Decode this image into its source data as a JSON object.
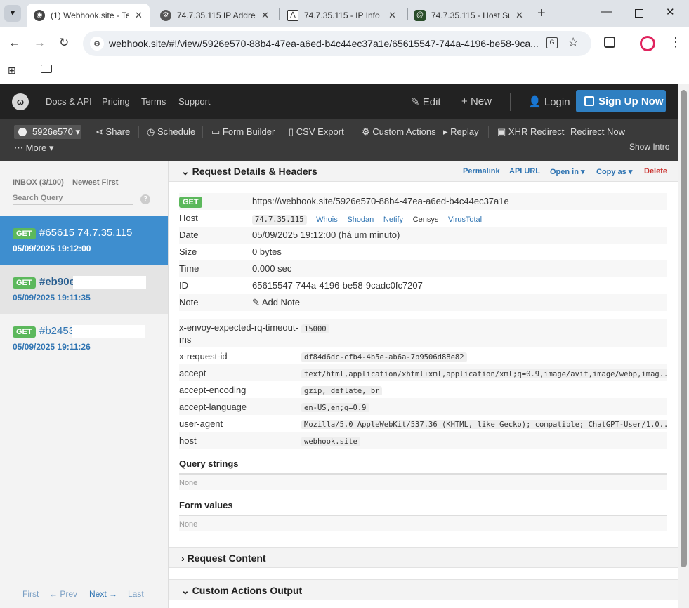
{
  "browser": {
    "tabs": [
      {
        "title": "(1) Webhook.site - Te",
        "active": true
      },
      {
        "title": "74.7.35.115 IP Addre"
      },
      {
        "title": "74.7.35.115 - IP Info"
      },
      {
        "title": "74.7.35.115 - Host Su"
      }
    ],
    "url": "webhook.site/#!/view/5926e570-88b4-47ea-a6ed-b4c44ec37a1e/65615547-744a-4196-be58-9ca..."
  },
  "topnav": {
    "links": [
      "Docs & API",
      "Pricing",
      "Terms",
      "Support"
    ],
    "edit": "Edit",
    "new": "New",
    "login": "Login",
    "signup": "Sign Up Now"
  },
  "toolbar": {
    "token": "5926e570",
    "items": [
      "Share",
      "Schedule",
      "Form Builder",
      "CSV Export",
      "Custom Actions",
      "Replay",
      "XHR Redirect",
      "Redirect Now"
    ],
    "more": "More",
    "show_intro": "Show Intro"
  },
  "sidebar": {
    "inbox": "INBOX (3/100)",
    "newest": "Newest First",
    "search_placeholder": "Search Query",
    "requests": [
      {
        "method": "GET",
        "id": "#65615 74.7.35.115",
        "time": "05/09/2025 19:12:00"
      },
      {
        "method": "GET",
        "id": "#eb90e",
        "time": "05/09/2025 19:11:35"
      },
      {
        "method": "GET",
        "id": "#b2453",
        "time": "05/09/2025 19:11:26"
      }
    ],
    "pager": {
      "first": "First",
      "prev": "← Prev",
      "next": "Next →",
      "last": "Last"
    }
  },
  "details": {
    "title": "Request Details & Headers",
    "actions": {
      "permalink": "Permalink",
      "api_url": "API URL",
      "open_in": "Open in",
      "copy_as": "Copy as",
      "delete": "Delete"
    },
    "method": "GET",
    "url": "https://webhook.site/5926e570-88b4-47ea-a6ed-b4c44ec37a1e",
    "host_label": "Host",
    "host": "74.7.35.115",
    "host_links": [
      "Whois",
      "Shodan",
      "Netify",
      "Censys",
      "VirusTotal"
    ],
    "date_label": "Date",
    "date": "05/09/2025 19:12:00 (há um minuto)",
    "size_label": "Size",
    "size": "0 bytes",
    "time_label": "Time",
    "time": "0.000 sec",
    "id_label": "ID",
    "id": "65615547-744a-4196-be58-9cadc0fc7207",
    "note_label": "Note",
    "add_note": "Add Note"
  },
  "headers": [
    {
      "k": "x-envoy-expected-rq-timeout-ms",
      "v": "15000"
    },
    {
      "k": "x-request-id",
      "v": "df84d6dc-cfb4-4b5e-ab6a-7b9506d88e82"
    },
    {
      "k": "accept",
      "v": "text/html,application/xhtml+xml,application/xml;q=0.9,image/avif,image/webp,imag..."
    },
    {
      "k": "accept-encoding",
      "v": "gzip, deflate, br"
    },
    {
      "k": "accept-language",
      "v": "en-US,en;q=0.9"
    },
    {
      "k": "user-agent",
      "v": "Mozilla/5.0 AppleWebKit/537.36 (KHTML, like Gecko); compatible; ChatGPT-User/1.0..."
    },
    {
      "k": "host",
      "v": "webhook.site"
    }
  ],
  "query_strings": {
    "title": "Query strings",
    "value": "None"
  },
  "form_values": {
    "title": "Form values",
    "value": "None"
  },
  "request_content": "Request Content",
  "custom_actions_output": "Custom Actions Output"
}
